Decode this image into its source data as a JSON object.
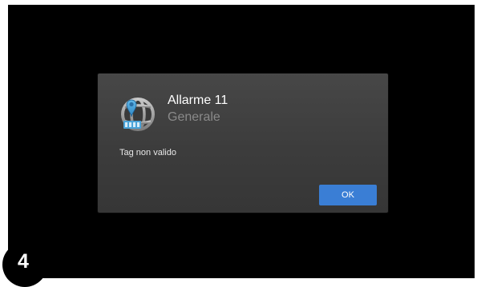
{
  "dialog": {
    "title": "Allarme 11",
    "subtitle": "Generale",
    "message": "Tag non valido",
    "ok_label": "OK",
    "icon": "globe-location-pin-icon"
  },
  "step_badge": {
    "number": "4"
  },
  "colors": {
    "screen_background": "#000000",
    "dialog_background": "#404040",
    "title_text": "#ffffff",
    "subtitle_text": "#8a8a8a",
    "button_accent": "#3a7ed5",
    "pin_color": "#4aa3d8"
  }
}
